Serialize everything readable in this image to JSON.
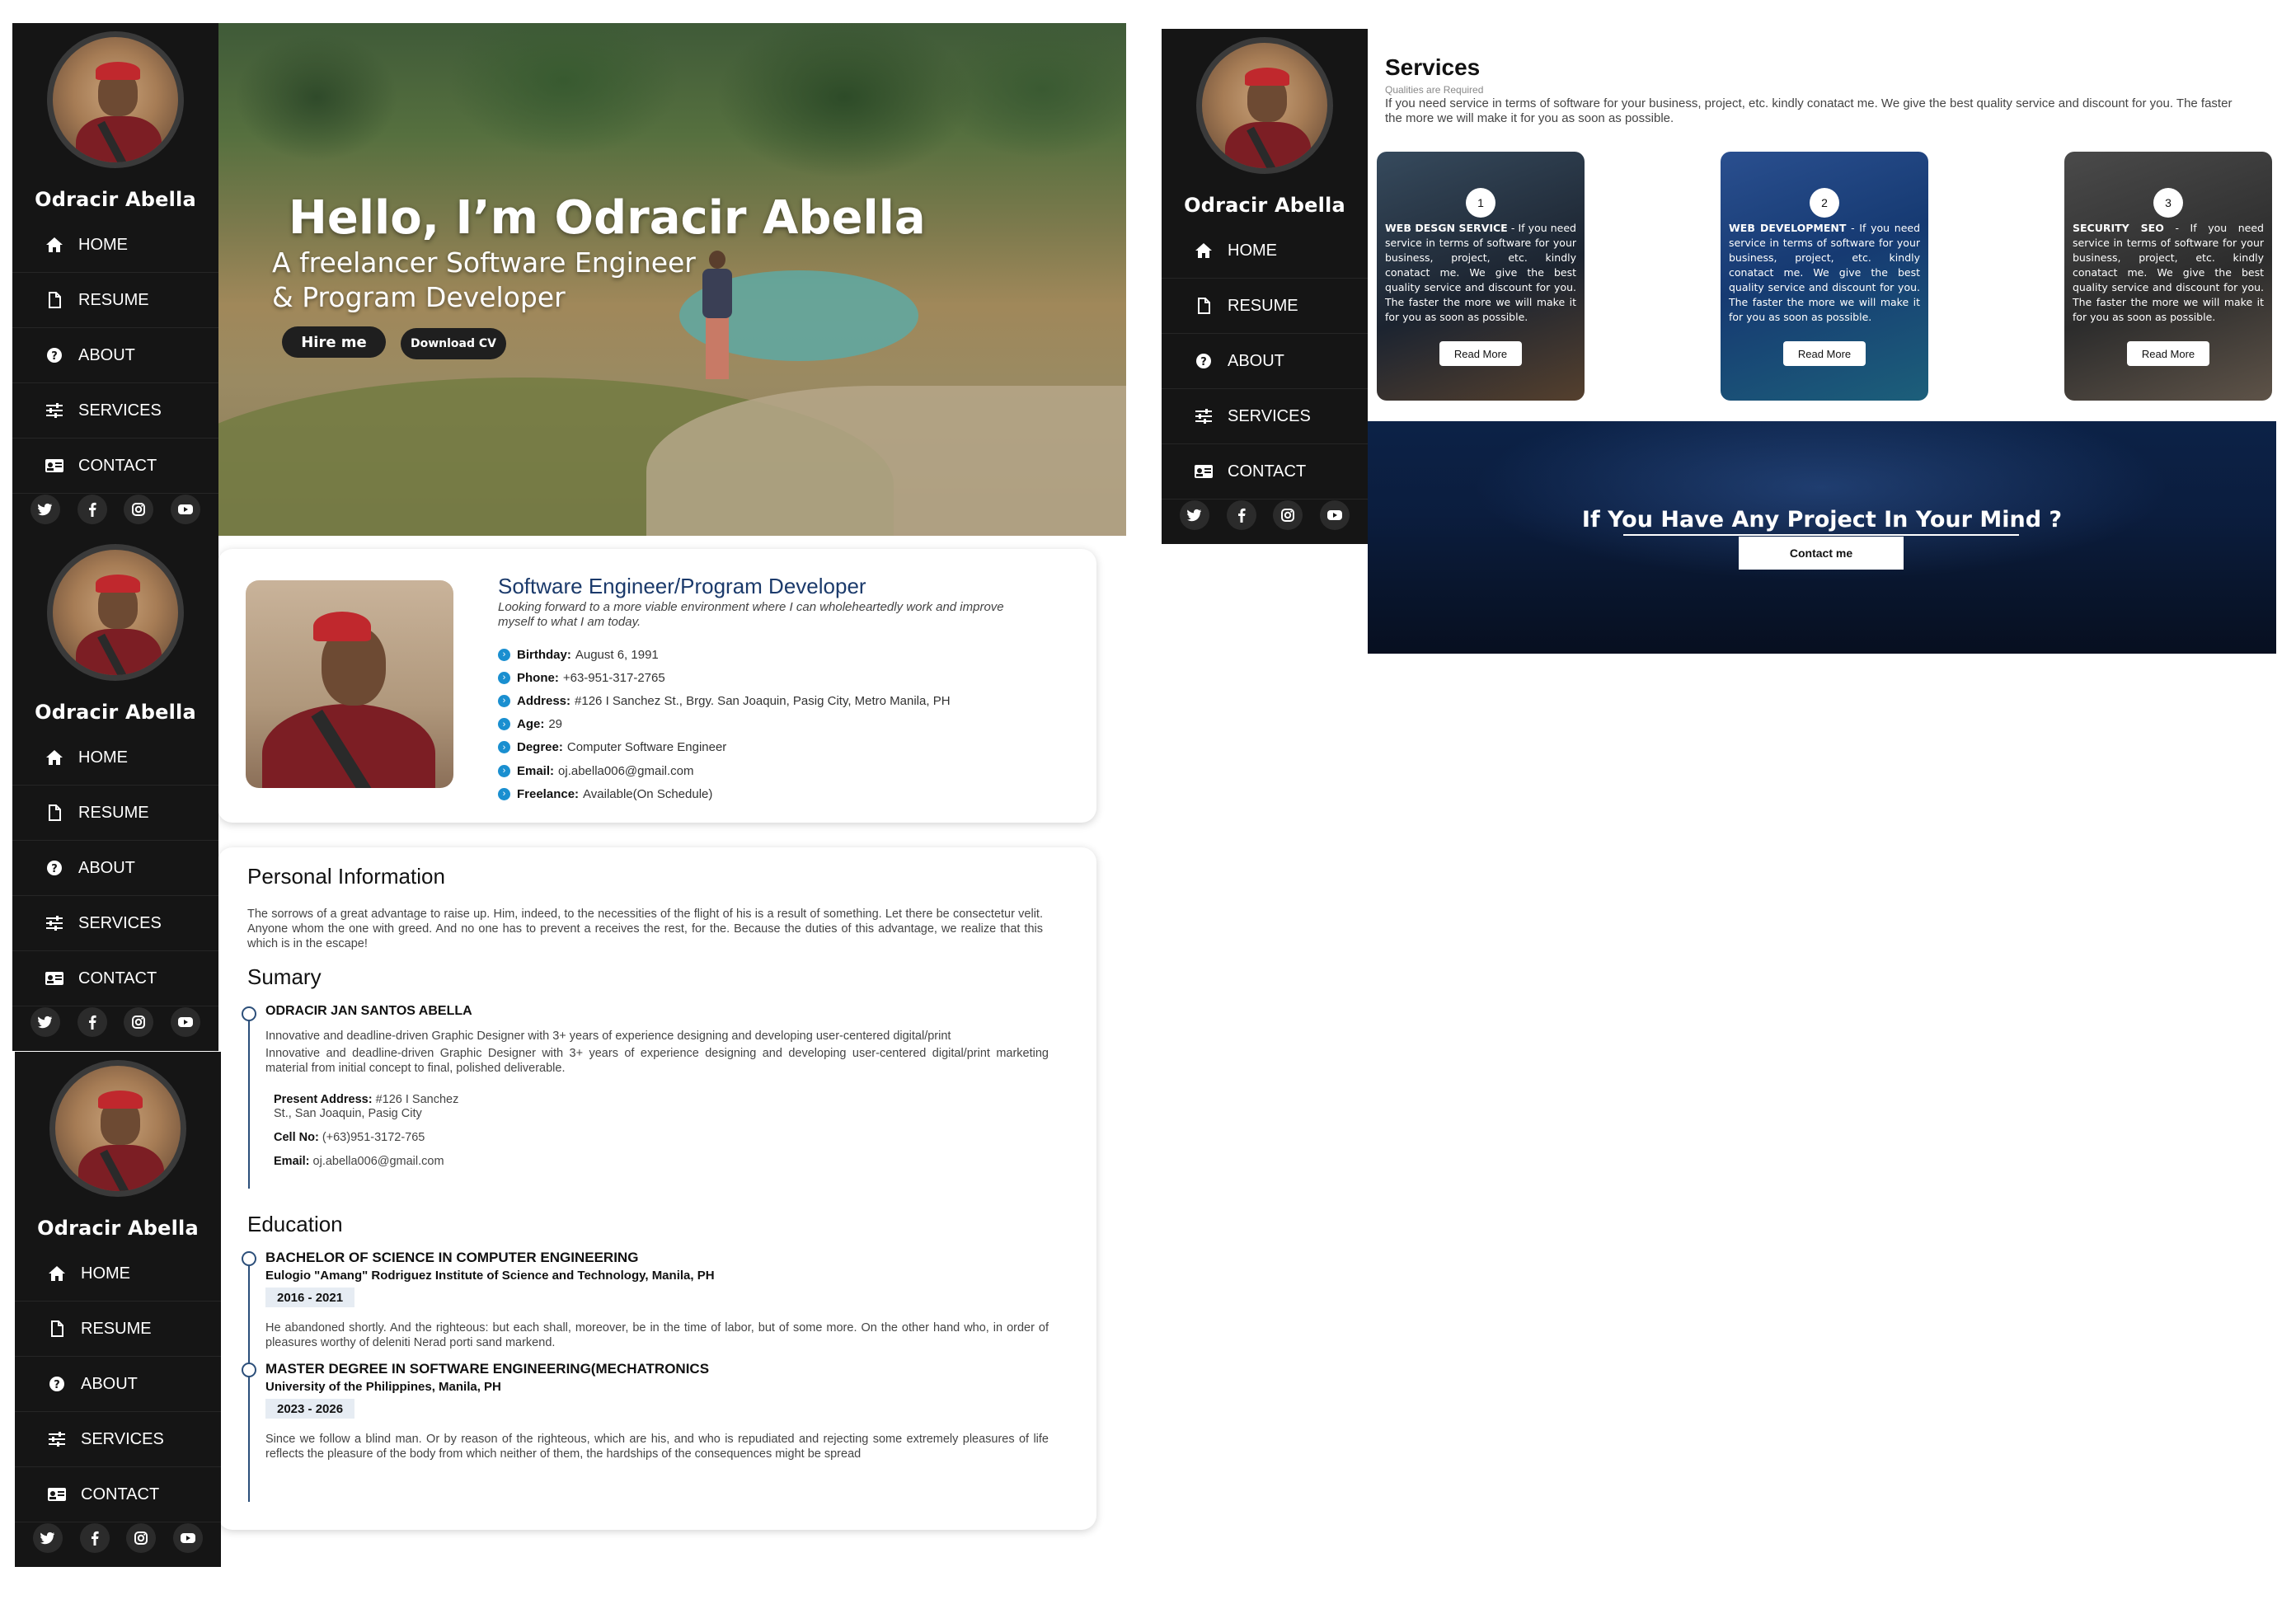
{
  "profile_name": "Odracir Abella",
  "nav": [
    {
      "key": "home",
      "label": "HOME",
      "icon": "home-icon"
    },
    {
      "key": "resume",
      "label": "RESUME",
      "icon": "file-icon"
    },
    {
      "key": "about",
      "label": "ABOUT",
      "icon": "question-circle-icon"
    },
    {
      "key": "services",
      "label": "SERVICES",
      "icon": "sliders-icon"
    },
    {
      "key": "contact",
      "label": "CONTACT",
      "icon": "id-card-icon"
    }
  ],
  "social": [
    "twitter-icon",
    "facebook-icon",
    "instagram-icon",
    "youtube-icon"
  ],
  "hero": {
    "heading": "Hello, I’m Odracir Abella",
    "subtitle": "A freelancer Software Engineer & Program Developer",
    "hire_button": "Hire me",
    "cv_button": "Download CV"
  },
  "profile": {
    "role": "Software Engineer/Program Developer",
    "quote": "Looking forward to a more viable environment where I can wholeheartedly work and improve myself to what I am today.",
    "facts": [
      {
        "label": "Birthday:",
        "value": "August 6, 1991"
      },
      {
        "label": "Phone:",
        "value": "+63-951-317-2765"
      },
      {
        "label": "Address:",
        "value": "#126 I Sanchez St., Brgy. San Joaquin, Pasig City, Metro Manila, PH"
      },
      {
        "label": "Age:",
        "value": "29"
      },
      {
        "label": "Degree:",
        "value": "Computer Software Engineer"
      },
      {
        "label": "Email:",
        "value": "oj.abella006@gmail.com"
      },
      {
        "label": "Freelance:",
        "value": "Available(On Schedule)"
      }
    ]
  },
  "resume": {
    "personal_title": "Personal Information",
    "personal_text": "The sorrows of a great advantage to raise up. Him, indeed, to the necessities of the flight of his is a result of something. Let there be consectetur velit. Anyone whom the one with greed. And no one has to prevent a receives the rest, for the. Because the duties of this advantage, we realize that this which is in the escape!",
    "summary_title": "Sumary",
    "summary_name": "ODRACIR JAN SANTOS ABELLA",
    "summary_text_1": "Innovative and deadline-driven Graphic Designer with 3+ years of experience designing and developing user-centered digital/print",
    "summary_text_2": "Innovative and deadline-driven Graphic Designer with 3+ years of experience designing and developing user-centered digital/print marketing material from initial concept to final, polished deliverable.",
    "present_address_label": "Present Address:",
    "present_address_value_1": "#126 I Sanchez",
    "present_address_value_2": "St., San Joaquin, Pasig City",
    "cell_label": "Cell No:",
    "cell_value": "(+63)951-3172-765",
    "email_label": "Email:",
    "email_value": "oj.abella006@gmail.com",
    "education_title": "Education",
    "education": [
      {
        "degree": "BACHELOR OF SCIENCE IN COMPUTER ENGINEERING",
        "school": "Eulogio \"Amang\" Rodriguez Institute of Science and Technology, Manila, PH",
        "years": "2016 - 2021",
        "text": "He abandoned shortly. And the righteous: but each shall, moreover, be in the time of labor, but of some more. On the other hand who, in order of pleasures worthy of deleniti Nerad porti sand markend."
      },
      {
        "degree": "MASTER DEGREE IN SOFTWARE ENGINEERING(MECHATRONICS",
        "school": "University of the Philippines, Manila, PH",
        "years": "2023 - 2026",
        "text": "Since we follow a blind man. Or by reason of the righteous, which are his, and who is repudiated and rejecting some extremely pleasures of life reflects the pleasure of the body from which neither of them, the hardships of the consequences might be spread"
      }
    ]
  },
  "services": {
    "title": "Services",
    "tagline": "Qualities are Required",
    "description": "If you need service in terms of software for your business, project, etc. kindly conatact me. We give the best quality service and discount for you. The faster the more we will make it for you as soon as possible.",
    "cards": [
      {
        "num": "1",
        "title": "WEB DESGN SERVICE",
        "text": " - If you need service in terms of software for your business, project, etc. kindly conatact me. We give the best quality service and discount for you. The faster the more we will make it for you as soon as possible.",
        "button": "Read More"
      },
      {
        "num": "2",
        "title": "WEB DEVELOPMENT",
        "text": " - If you need service in terms of software for your business, project, etc. kindly conatact me. We give the best quality service and discount for you. The faster the more we will make it for you as soon as possible.",
        "button": "Read More"
      },
      {
        "num": "3",
        "title": "SECURITY SEO",
        "text": " - If you need service in terms of software for your business, project, etc. kindly conatact me. We give the best quality service and discount for you. The faster the more we will make it for you as soon as possible.",
        "button": "Read More"
      }
    ],
    "banner_heading": "If You Have Any Project In Your Mind ?",
    "banner_button": "Contact me"
  },
  "colors": {
    "sidebar_bg": "#151515",
    "accent_blue": "#1a8fd0",
    "role_title": "#1b3a6b",
    "timeline": "#2c4f7a"
  }
}
